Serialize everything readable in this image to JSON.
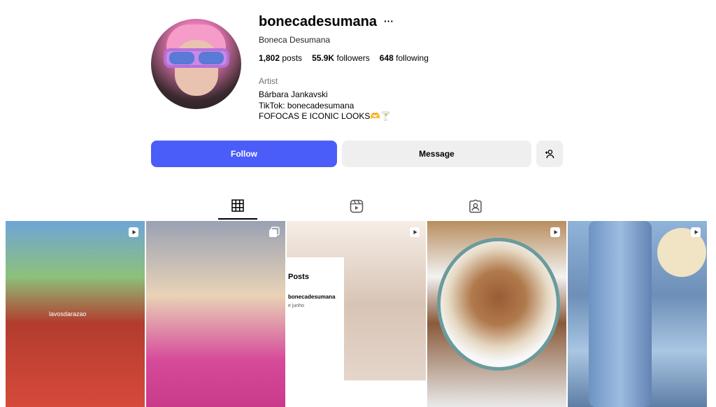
{
  "profile": {
    "username": "bonecadesumana",
    "more_icon": "ellipsis-icon",
    "full_name": "Boneca Desumana",
    "stats": {
      "posts_count": "1,802",
      "posts_label": "posts",
      "followers_count": "55.9K",
      "followers_label": "followers",
      "following_count": "648",
      "following_label": "following"
    },
    "category": "Artist",
    "bio_lines": [
      "Bárbara Jankavski",
      "TikTok: bonecadesumana",
      "FOFOCAS E ICONIC LOOKS🫶🍸"
    ]
  },
  "actions": {
    "follow_label": "Follow",
    "message_label": "Message",
    "add_user_icon": "person-add-icon"
  },
  "tabs": [
    {
      "name": "posts",
      "icon": "grid-icon",
      "active": true
    },
    {
      "name": "reels",
      "icon": "reels-icon",
      "active": false
    },
    {
      "name": "tagged",
      "icon": "tagged-icon",
      "active": false
    }
  ],
  "grid": {
    "tiles": [
      {
        "type": "reel",
        "overlay": "lavosdarazao"
      },
      {
        "type": "carousel"
      },
      {
        "type": "reel",
        "card_title": "Posts",
        "card_handle": "bonecadesumana",
        "card_date": "e junho"
      },
      {
        "type": "reel"
      },
      {
        "type": "reel"
      }
    ]
  },
  "colors": {
    "accent": "#4a5df9",
    "secondary_button": "#efefef",
    "muted_text": "#737373"
  }
}
